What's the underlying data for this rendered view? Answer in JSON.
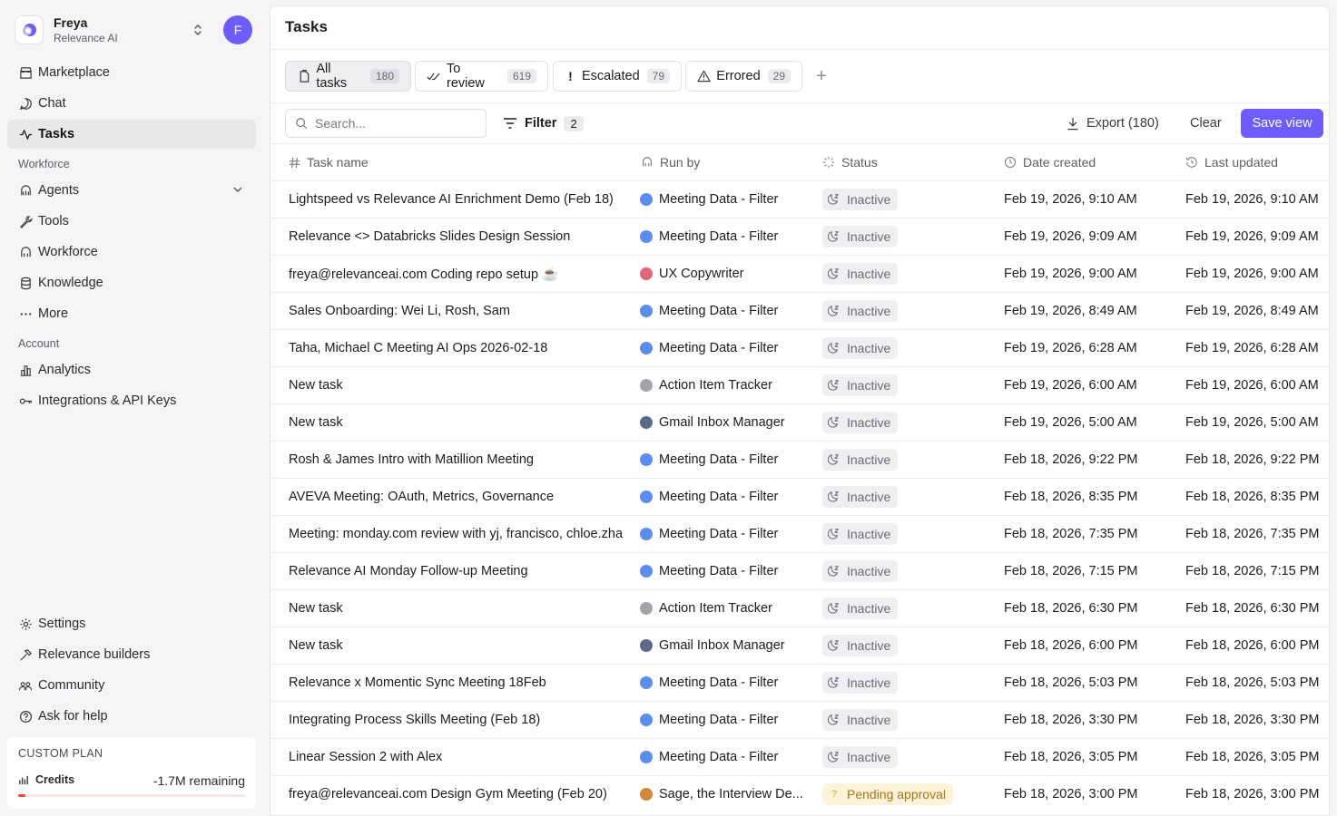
{
  "org": {
    "name": "Freya",
    "subtitle": "Relevance AI",
    "avatar_initial": "F"
  },
  "nav": {
    "primary": [
      {
        "label": "Marketplace",
        "icon": "store-icon"
      },
      {
        "label": "Chat",
        "icon": "chat-bubble-icon"
      },
      {
        "label": "Tasks",
        "icon": "activity-icon",
        "active": true
      }
    ],
    "workforce_label": "Workforce",
    "workforce": [
      {
        "label": "Agents",
        "icon": "agent-icon"
      },
      {
        "label": "Tools",
        "icon": "wrench-icon"
      },
      {
        "label": "Workforce",
        "icon": "workforce-icon"
      },
      {
        "label": "Knowledge",
        "icon": "database-icon"
      },
      {
        "label": "More",
        "icon": "ellipsis-icon"
      }
    ],
    "account_label": "Account",
    "account": [
      {
        "label": "Analytics",
        "icon": "bar-chart-icon"
      },
      {
        "label": "Integrations & API Keys",
        "icon": "key-icon"
      }
    ],
    "bottom": [
      {
        "label": "Settings",
        "icon": "gear-icon"
      },
      {
        "label": "Relevance builders",
        "icon": "hammer-icon"
      },
      {
        "label": "Community",
        "icon": "people-icon"
      },
      {
        "label": "Ask for help",
        "icon": "help-circle-icon"
      }
    ]
  },
  "plan": {
    "title": "CUSTOM PLAN",
    "credits_label": "Credits",
    "remaining": "-1.7M remaining",
    "usage_fraction": 0.03
  },
  "page": {
    "title": "Tasks"
  },
  "tabs": [
    {
      "label": "All tasks",
      "count": "180",
      "icon": "document-icon"
    },
    {
      "label": "To review",
      "count": "619",
      "icon": "double-check-icon"
    },
    {
      "label": "Escalated",
      "count": "79",
      "icon": "exclamation-icon"
    },
    {
      "label": "Errored",
      "count": "29",
      "icon": "warning-triangle-icon"
    }
  ],
  "toolbar": {
    "search_placeholder": "Search...",
    "filter_label": "Filter",
    "filter_count": "2",
    "export_label": "Export (180)",
    "clear_label": "Clear",
    "save_label": "Save view"
  },
  "columns": {
    "task_name": "Task name",
    "run_by": "Run by",
    "status": "Status",
    "date_created": "Date created",
    "last_updated": "Last updated"
  },
  "colors": {
    "accent": "#6d5dfc",
    "pending_bg": "#fdf3d8",
    "pending_text": "#a8741a"
  },
  "rows": [
    {
      "name": "Lightspeed vs Relevance AI Enrichment Demo (Feb 18)",
      "run_by": "Meeting Data - Filter",
      "status": "Inactive",
      "created": "Feb 19, 2026, 9:10 AM",
      "updated": "Feb 19, 2026, 9:10 AM"
    },
    {
      "name": "Relevance <> Databricks Slides Design Session",
      "run_by": "Meeting Data - Filter",
      "status": "Inactive",
      "created": "Feb 19, 2026, 9:09 AM",
      "updated": "Feb 19, 2026, 9:09 AM"
    },
    {
      "name": "freya@relevanceai.com Coding repo setup ☕",
      "run_by": "UX Copywriter",
      "status": "Inactive",
      "created": "Feb 19, 2026, 9:00 AM",
      "updated": "Feb 19, 2026, 9:00 AM"
    },
    {
      "name": "Sales Onboarding: Wei Li, Rosh, Sam",
      "run_by": "Meeting Data - Filter",
      "status": "Inactive",
      "created": "Feb 19, 2026, 8:49 AM",
      "updated": "Feb 19, 2026, 8:49 AM"
    },
    {
      "name": "Taha, Michael C Meeting AI Ops 2026-02-18",
      "run_by": "Meeting Data - Filter",
      "status": "Inactive",
      "created": "Feb 19, 2026, 6:28 AM",
      "updated": "Feb 19, 2026, 6:28 AM"
    },
    {
      "name": "New task",
      "run_by": "Action Item Tracker",
      "status": "Inactive",
      "created": "Feb 19, 2026, 6:00 AM",
      "updated": "Feb 19, 2026, 6:00 AM"
    },
    {
      "name": "New task",
      "run_by": "Gmail Inbox Manager",
      "status": "Inactive",
      "created": "Feb 19, 2026, 5:00 AM",
      "updated": "Feb 19, 2026, 5:00 AM"
    },
    {
      "name": "Rosh & James Intro with Matillion Meeting",
      "run_by": "Meeting Data - Filter",
      "status": "Inactive",
      "created": "Feb 18, 2026, 9:22 PM",
      "updated": "Feb 18, 2026, 9:22 PM"
    },
    {
      "name": "AVEVA Meeting: OAuth, Metrics, Governance",
      "run_by": "Meeting Data - Filter",
      "status": "Inactive",
      "created": "Feb 18, 2026, 8:35 PM",
      "updated": "Feb 18, 2026, 8:35 PM"
    },
    {
      "name": "Meeting: monday.com review with yj, francisco, chloe.zha",
      "run_by": "Meeting Data - Filter",
      "status": "Inactive",
      "created": "Feb 18, 2026, 7:35 PM",
      "updated": "Feb 18, 2026, 7:35 PM"
    },
    {
      "name": "Relevance AI Monday Follow-up Meeting",
      "run_by": "Meeting Data - Filter",
      "status": "Inactive",
      "created": "Feb 18, 2026, 7:15 PM",
      "updated": "Feb 18, 2026, 7:15 PM"
    },
    {
      "name": "New task",
      "run_by": "Action Item Tracker",
      "status": "Inactive",
      "created": "Feb 18, 2026, 6:30 PM",
      "updated": "Feb 18, 2026, 6:30 PM"
    },
    {
      "name": "New task",
      "run_by": "Gmail Inbox Manager",
      "status": "Inactive",
      "created": "Feb 18, 2026, 6:00 PM",
      "updated": "Feb 18, 2026, 6:00 PM"
    },
    {
      "name": "Relevance x Momentic Sync Meeting 18Feb",
      "run_by": "Meeting Data - Filter",
      "status": "Inactive",
      "created": "Feb 18, 2026, 5:03 PM",
      "updated": "Feb 18, 2026, 5:03 PM"
    },
    {
      "name": "Integrating Process Skills Meeting (Feb 18)",
      "run_by": "Meeting Data - Filter",
      "status": "Inactive",
      "created": "Feb 18, 2026, 3:30 PM",
      "updated": "Feb 18, 2026, 3:30 PM"
    },
    {
      "name": "Linear Session 2 with Alex",
      "run_by": "Meeting Data - Filter",
      "status": "Inactive",
      "created": "Feb 18, 2026, 3:05 PM",
      "updated": "Feb 18, 2026, 3:05 PM"
    },
    {
      "name": "freya@relevanceai.com Design Gym Meeting (Feb 20)",
      "run_by": "Sage, the Interview De...",
      "status": "Pending approval",
      "created": "Feb 18, 2026, 3:00 PM",
      "updated": "Feb 18, 2026, 3:00 PM"
    }
  ]
}
